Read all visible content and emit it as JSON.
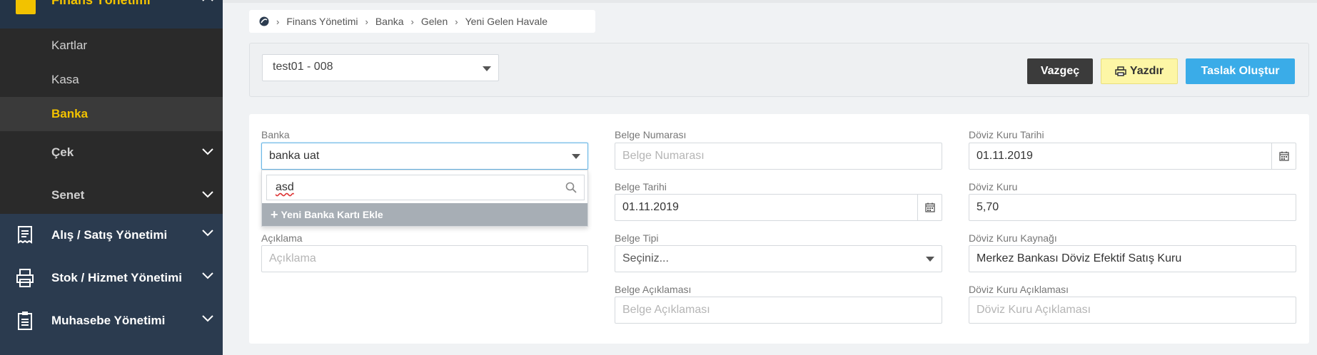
{
  "sidebar": {
    "finans_label": "Finans Yönetimi",
    "sub_items": [
      {
        "label": "Kartlar"
      },
      {
        "label": "Kasa"
      },
      {
        "label": "Banka"
      },
      {
        "label": "Çek"
      },
      {
        "label": "Senet"
      }
    ],
    "main_items": [
      {
        "label": "Alış / Satış Yönetimi",
        "icon": "receipt-icon"
      },
      {
        "label": "Stok / Hizmet Yönetimi",
        "icon": "printer-stock-icon"
      },
      {
        "label": "Muhasebe Yönetimi",
        "icon": "clipboard-icon"
      }
    ],
    "accent_color": "#f2c200"
  },
  "breadcrumb": {
    "items": [
      "Finans Yönetimi",
      "Banka",
      "Gelen",
      "Yeni Gelen Havale"
    ]
  },
  "toolbar": {
    "company_select": "test01 - 008",
    "cancel_label": "Vazgeç",
    "print_label": "Yazdır",
    "draft_label": "Taslak Oluştur"
  },
  "form": {
    "banka": {
      "label": "Banka",
      "value": "banka uat"
    },
    "banka_dropdown": {
      "search_value": "asd",
      "add_label": "Yeni Banka Kartı Ekle"
    },
    "aciklama": {
      "label": "Açıklama",
      "placeholder": "Açıklama"
    },
    "belge_numarasi": {
      "label": "Belge Numarası",
      "placeholder": "Belge Numarası"
    },
    "belge_tarihi": {
      "label": "Belge Tarihi",
      "value": "01.11.2019"
    },
    "belge_tipi": {
      "label": "Belge Tipi",
      "value": "Seçiniz..."
    },
    "belge_aciklamasi": {
      "label": "Belge Açıklaması",
      "placeholder": "Belge Açıklaması"
    },
    "doviz_kuru_tarihi": {
      "label": "Döviz Kuru Tarihi",
      "value": "01.11.2019"
    },
    "doviz_kuru": {
      "label": "Döviz Kuru",
      "value": "5,70"
    },
    "doviz_kuru_kaynagi": {
      "label": "Döviz Kuru Kaynağı",
      "value": "Merkez Bankası Döviz Efektif Satış Kuru"
    },
    "doviz_kuru_aciklamasi": {
      "label": "Döviz Kuru Açıklaması",
      "placeholder": "Döviz Kuru Açıklaması"
    }
  }
}
